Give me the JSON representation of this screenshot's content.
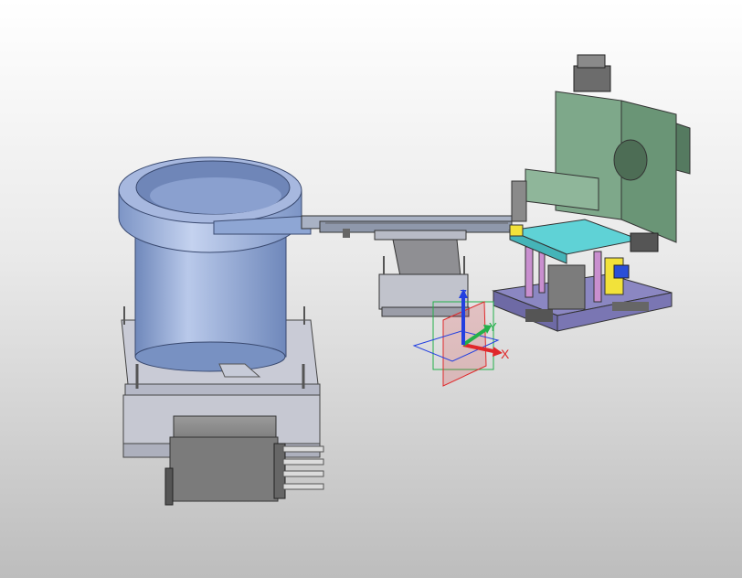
{
  "viewport": {
    "background_top": "#ffffff",
    "background_bottom": "#bdbdbd"
  },
  "colors": {
    "bowl": "#8ea6d4",
    "bowl_dark": "#6f88bb",
    "bowl_light": "#b9c9ea",
    "base_plate": "#c9cbd6",
    "track": "#a9b2c4",
    "frame_green": "#7ea88a",
    "plate_cyan": "#5fd2d6",
    "base_purple": "#8b87c2",
    "post_pink": "#c98fcf",
    "motor_grey": "#8a8a8a",
    "accent_yellow": "#f2e23a",
    "accent_blue": "#2a4fd8"
  },
  "components": [
    "vibratory-bowl",
    "bowl-base",
    "drive-unit",
    "linear-feeder-track",
    "track-support",
    "assembly-station"
  ],
  "triad": {
    "x_label": "X",
    "y_label": "Y",
    "z_label": "Z",
    "x_color": "#e0282a",
    "y_color": "#23b04a",
    "z_color": "#2340e0"
  }
}
